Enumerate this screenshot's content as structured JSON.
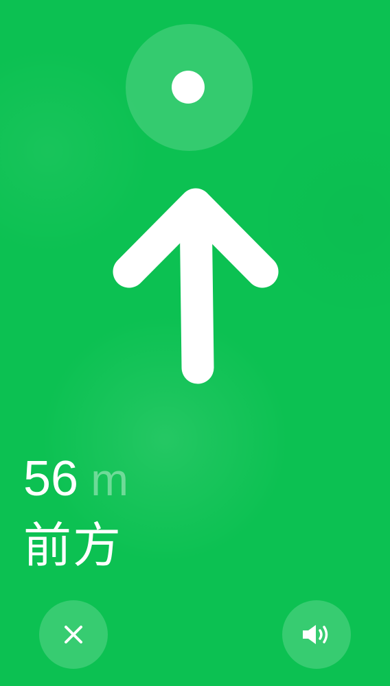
{
  "navigation": {
    "distance_value": "56",
    "distance_unit": "m",
    "direction_text": "前方"
  },
  "controls": {
    "close_icon": "close-icon",
    "sound_icon": "speaker-icon"
  },
  "colors": {
    "background": "#0cc152",
    "foreground": "#ffffff"
  }
}
